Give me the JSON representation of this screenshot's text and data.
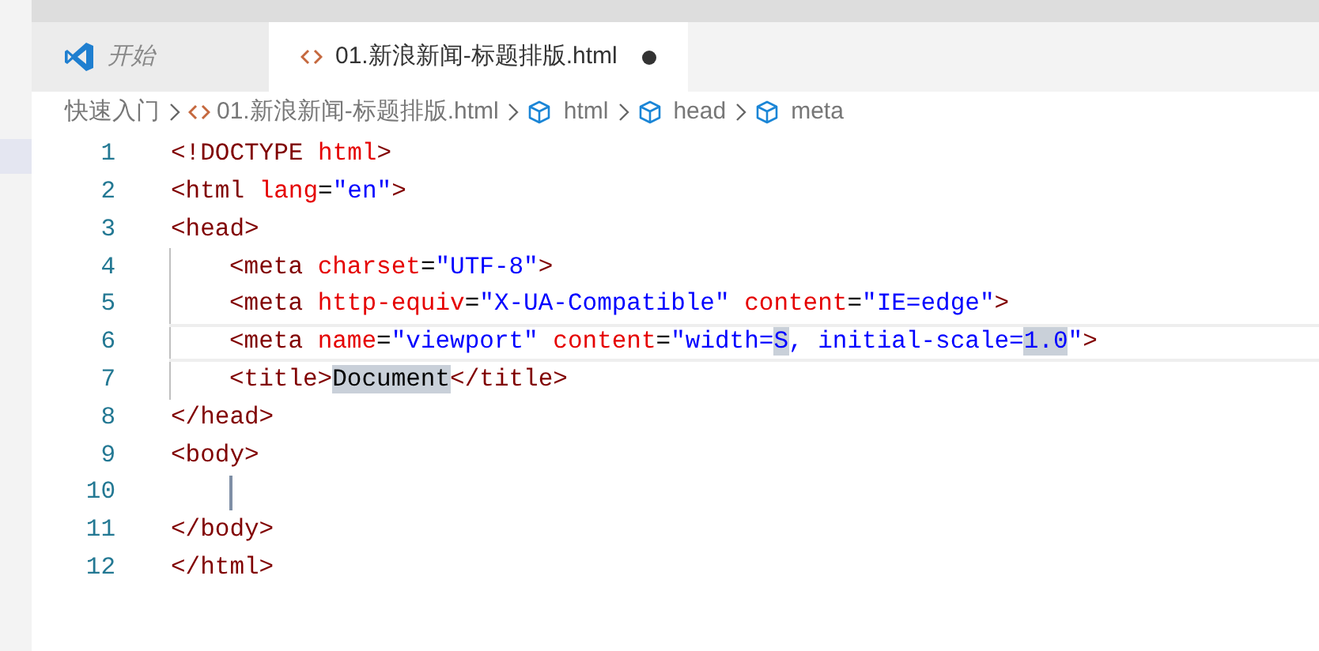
{
  "tabs": [
    {
      "label": "开始",
      "kind": "welcome",
      "selected": false,
      "dirty": false
    },
    {
      "label": "01.新浪新闻-标题排版.html",
      "kind": "file",
      "selected": true,
      "dirty": true
    }
  ],
  "breadcrumb": [
    {
      "label": "快速入门",
      "kind": "folder"
    },
    {
      "label": "01.新浪新闻-标题排版.html",
      "kind": "file"
    },
    {
      "label": "html",
      "kind": "symbol"
    },
    {
      "label": "head",
      "kind": "symbol"
    },
    {
      "label": "meta",
      "kind": "symbol"
    }
  ],
  "lines": [
    {
      "number": "1",
      "indented": false,
      "guide": false,
      "current": false,
      "cursor": false,
      "tokens": [
        {
          "text": "<!DOCTYPE",
          "kind": "tag",
          "highlighted": false
        },
        {
          "text": " html",
          "kind": "attr",
          "highlighted": false
        },
        {
          "text": ">",
          "kind": "tag",
          "highlighted": false
        }
      ]
    },
    {
      "number": "2",
      "indented": false,
      "guide": false,
      "current": false,
      "cursor": false,
      "tokens": [
        {
          "text": "<html",
          "kind": "tag",
          "highlighted": false
        },
        {
          "text": " lang",
          "kind": "attr",
          "highlighted": false
        },
        {
          "text": "=",
          "kind": "plain",
          "highlighted": false
        },
        {
          "text": "\"en\"",
          "kind": "value",
          "highlighted": false
        },
        {
          "text": ">",
          "kind": "tag",
          "highlighted": false
        }
      ]
    },
    {
      "number": "3",
      "indented": false,
      "guide": false,
      "current": false,
      "cursor": false,
      "tokens": [
        {
          "text": "<head>",
          "kind": "tag",
          "highlighted": false
        }
      ]
    },
    {
      "number": "4",
      "indented": true,
      "guide": true,
      "current": false,
      "cursor": false,
      "tokens": [
        {
          "text": "<meta",
          "kind": "tag",
          "highlighted": false
        },
        {
          "text": " charset",
          "kind": "attr",
          "highlighted": false
        },
        {
          "text": "=",
          "kind": "plain",
          "highlighted": false
        },
        {
          "text": "\"UTF-8\"",
          "kind": "value",
          "highlighted": false
        },
        {
          "text": ">",
          "kind": "tag",
          "highlighted": false
        }
      ]
    },
    {
      "number": "5",
      "indented": true,
      "guide": true,
      "current": false,
      "cursor": false,
      "tokens": [
        {
          "text": "<meta",
          "kind": "tag",
          "highlighted": false
        },
        {
          "text": " http-equiv",
          "kind": "attr",
          "highlighted": false
        },
        {
          "text": "=",
          "kind": "plain",
          "highlighted": false
        },
        {
          "text": "\"X-UA-Compatible\"",
          "kind": "value",
          "highlighted": false
        },
        {
          "text": " content",
          "kind": "attr",
          "highlighted": false
        },
        {
          "text": "=",
          "kind": "plain",
          "highlighted": false
        },
        {
          "text": "\"IE=edge\"",
          "kind": "value",
          "highlighted": false
        },
        {
          "text": ">",
          "kind": "tag",
          "highlighted": false
        }
      ]
    },
    {
      "number": "6",
      "indented": true,
      "guide": true,
      "current": true,
      "cursor": false,
      "tokens": [
        {
          "text": "<meta",
          "kind": "tag",
          "highlighted": false
        },
        {
          "text": " name",
          "kind": "attr",
          "highlighted": false
        },
        {
          "text": "=",
          "kind": "plain",
          "highlighted": false
        },
        {
          "text": "\"viewport\"",
          "kind": "value",
          "highlighted": false
        },
        {
          "text": " content",
          "kind": "attr",
          "highlighted": false
        },
        {
          "text": "=",
          "kind": "plain",
          "highlighted": false
        },
        {
          "text": "\"width=",
          "kind": "value",
          "highlighted": false
        },
        {
          "text": "S",
          "kind": "value",
          "highlighted": true
        },
        {
          "text": ", initial-scale=",
          "kind": "value",
          "highlighted": false
        },
        {
          "text": "1.0",
          "kind": "value",
          "highlighted": true
        },
        {
          "text": "\"",
          "kind": "value",
          "highlighted": false
        },
        {
          "text": ">",
          "kind": "tag",
          "highlighted": false
        }
      ]
    },
    {
      "number": "7",
      "indented": true,
      "guide": true,
      "current": false,
      "cursor": false,
      "tokens": [
        {
          "text": "<title>",
          "kind": "tag",
          "highlighted": false
        },
        {
          "text": "Document",
          "kind": "plain",
          "highlighted": true
        },
        {
          "text": "</title>",
          "kind": "tag",
          "highlighted": false
        }
      ]
    },
    {
      "number": "8",
      "indented": false,
      "guide": false,
      "current": false,
      "cursor": false,
      "tokens": [
        {
          "text": "</head>",
          "kind": "tag",
          "highlighted": false
        }
      ]
    },
    {
      "number": "9",
      "indented": false,
      "guide": false,
      "current": false,
      "cursor": false,
      "tokens": [
        {
          "text": "<body>",
          "kind": "tag",
          "highlighted": false
        }
      ]
    },
    {
      "number": "10",
      "indented": true,
      "guide": false,
      "current": false,
      "cursor": true
    },
    {
      "number": "11",
      "indented": false,
      "guide": false,
      "current": false,
      "cursor": false,
      "tokens": [
        {
          "text": "</body>",
          "kind": "tag",
          "highlighted": false
        }
      ]
    },
    {
      "number": "12",
      "indented": false,
      "guide": false,
      "current": false,
      "cursor": false,
      "tokens": [
        {
          "text": "</html>",
          "kind": "tag",
          "highlighted": false
        }
      ]
    }
  ]
}
